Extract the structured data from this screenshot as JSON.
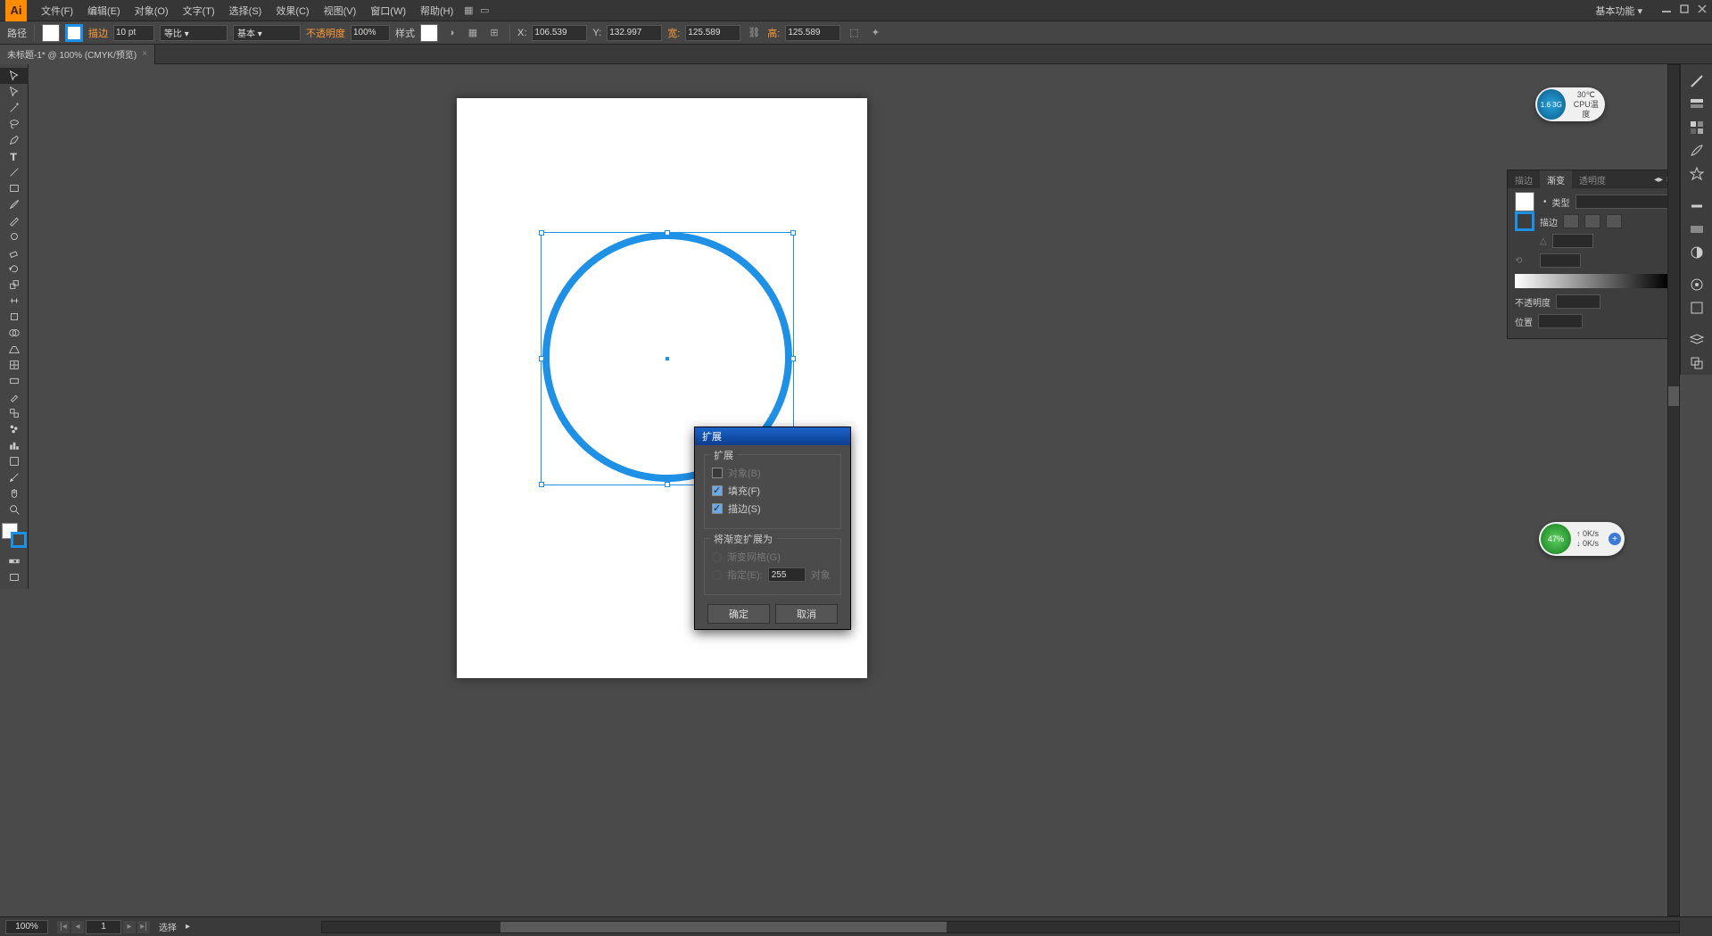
{
  "menubar": {
    "items": [
      "文件(F)",
      "编辑(E)",
      "对象(O)",
      "文字(T)",
      "选择(S)",
      "效果(C)",
      "视图(V)",
      "窗口(W)",
      "帮助(H)"
    ],
    "workspace_label": "基本功能"
  },
  "controlbar": {
    "path_label": "路径",
    "stroke_label": "描边",
    "stroke_weight": "10 pt",
    "profile_label": "等比",
    "brush_label": "基本",
    "opacity_label": "不透明度",
    "opacity_value": "100%",
    "style_label": "样式",
    "x_label": "X:",
    "x_value": "106.539",
    "y_label": "Y:",
    "y_value": "132.997",
    "w_label": "宽:",
    "w_value": "125.589",
    "h_label": "高:",
    "h_value": "125.589"
  },
  "tab": {
    "title": "未标题-1* @ 100% (CMYK/预览)"
  },
  "gradient_panel": {
    "tabs": [
      "描边",
      "渐变",
      "透明度"
    ],
    "type_label": "类型",
    "stroke_label": "描边",
    "opacity_label": "不透明度",
    "position_label": "位置"
  },
  "dialog": {
    "title": "扩展",
    "group1_title": "扩展",
    "opt_object": "对象(B)",
    "opt_fill": "填充(F)",
    "opt_stroke": "描边(S)",
    "group2_title": "将渐变扩展为",
    "opt_mesh": "渐变网格(G)",
    "opt_specify": "指定(E):",
    "specify_value": "255",
    "specify_unit": "对象",
    "ok_label": "确定",
    "cancel_label": "取消"
  },
  "statusbar": {
    "zoom": "100%",
    "page": "1",
    "mode": "选择"
  },
  "widgets": {
    "cpu_val": "1.6 3G",
    "cpu_temp": "30℃",
    "cpu_label": "CPU温度",
    "net_val": "47%",
    "net_up": "↑ 0K/s",
    "net_down": "↓ 0K/s"
  }
}
